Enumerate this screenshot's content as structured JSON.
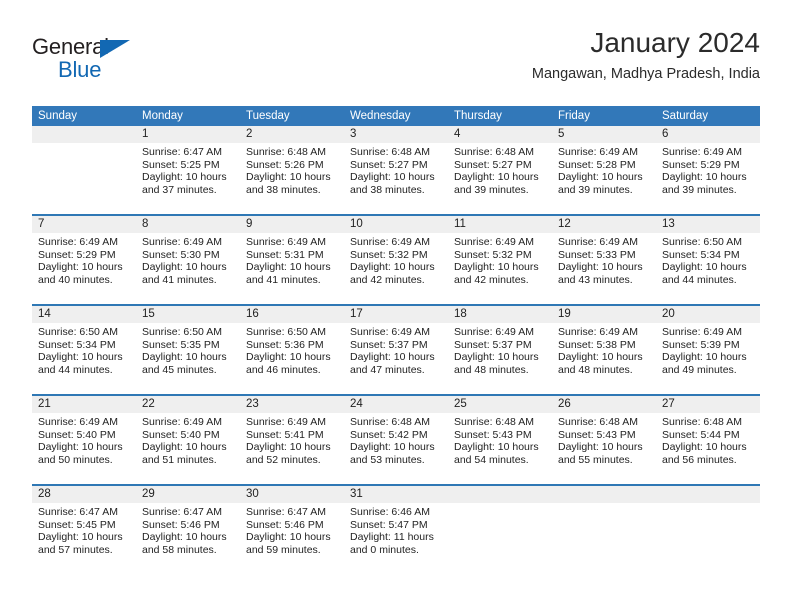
{
  "brand": {
    "name_part1": "General",
    "name_part2": "Blue",
    "accent_color": "#1268b3"
  },
  "header": {
    "title": "January 2024",
    "subtitle": "Mangawan, Madhya Pradesh, India"
  },
  "theme": {
    "header_bg": "#3278b9",
    "daynum_bg": "#efefef",
    "divider": "#2f78b5"
  },
  "weekday_headers": [
    "Sunday",
    "Monday",
    "Tuesday",
    "Wednesday",
    "Thursday",
    "Friday",
    "Saturday"
  ],
  "weeks": [
    [
      {
        "day": "",
        "sunrise": "",
        "sunset": "",
        "daylight_1": "",
        "daylight_2": ""
      },
      {
        "day": "1",
        "sunrise": "Sunrise: 6:47 AM",
        "sunset": "Sunset: 5:25 PM",
        "daylight_1": "Daylight: 10 hours",
        "daylight_2": "and 37 minutes."
      },
      {
        "day": "2",
        "sunrise": "Sunrise: 6:48 AM",
        "sunset": "Sunset: 5:26 PM",
        "daylight_1": "Daylight: 10 hours",
        "daylight_2": "and 38 minutes."
      },
      {
        "day": "3",
        "sunrise": "Sunrise: 6:48 AM",
        "sunset": "Sunset: 5:27 PM",
        "daylight_1": "Daylight: 10 hours",
        "daylight_2": "and 38 minutes."
      },
      {
        "day": "4",
        "sunrise": "Sunrise: 6:48 AM",
        "sunset": "Sunset: 5:27 PM",
        "daylight_1": "Daylight: 10 hours",
        "daylight_2": "and 39 minutes."
      },
      {
        "day": "5",
        "sunrise": "Sunrise: 6:49 AM",
        "sunset": "Sunset: 5:28 PM",
        "daylight_1": "Daylight: 10 hours",
        "daylight_2": "and 39 minutes."
      },
      {
        "day": "6",
        "sunrise": "Sunrise: 6:49 AM",
        "sunset": "Sunset: 5:29 PM",
        "daylight_1": "Daylight: 10 hours",
        "daylight_2": "and 39 minutes."
      }
    ],
    [
      {
        "day": "7",
        "sunrise": "Sunrise: 6:49 AM",
        "sunset": "Sunset: 5:29 PM",
        "daylight_1": "Daylight: 10 hours",
        "daylight_2": "and 40 minutes."
      },
      {
        "day": "8",
        "sunrise": "Sunrise: 6:49 AM",
        "sunset": "Sunset: 5:30 PM",
        "daylight_1": "Daylight: 10 hours",
        "daylight_2": "and 41 minutes."
      },
      {
        "day": "9",
        "sunrise": "Sunrise: 6:49 AM",
        "sunset": "Sunset: 5:31 PM",
        "daylight_1": "Daylight: 10 hours",
        "daylight_2": "and 41 minutes."
      },
      {
        "day": "10",
        "sunrise": "Sunrise: 6:49 AM",
        "sunset": "Sunset: 5:32 PM",
        "daylight_1": "Daylight: 10 hours",
        "daylight_2": "and 42 minutes."
      },
      {
        "day": "11",
        "sunrise": "Sunrise: 6:49 AM",
        "sunset": "Sunset: 5:32 PM",
        "daylight_1": "Daylight: 10 hours",
        "daylight_2": "and 42 minutes."
      },
      {
        "day": "12",
        "sunrise": "Sunrise: 6:49 AM",
        "sunset": "Sunset: 5:33 PM",
        "daylight_1": "Daylight: 10 hours",
        "daylight_2": "and 43 minutes."
      },
      {
        "day": "13",
        "sunrise": "Sunrise: 6:50 AM",
        "sunset": "Sunset: 5:34 PM",
        "daylight_1": "Daylight: 10 hours",
        "daylight_2": "and 44 minutes."
      }
    ],
    [
      {
        "day": "14",
        "sunrise": "Sunrise: 6:50 AM",
        "sunset": "Sunset: 5:34 PM",
        "daylight_1": "Daylight: 10 hours",
        "daylight_2": "and 44 minutes."
      },
      {
        "day": "15",
        "sunrise": "Sunrise: 6:50 AM",
        "sunset": "Sunset: 5:35 PM",
        "daylight_1": "Daylight: 10 hours",
        "daylight_2": "and 45 minutes."
      },
      {
        "day": "16",
        "sunrise": "Sunrise: 6:50 AM",
        "sunset": "Sunset: 5:36 PM",
        "daylight_1": "Daylight: 10 hours",
        "daylight_2": "and 46 minutes."
      },
      {
        "day": "17",
        "sunrise": "Sunrise: 6:49 AM",
        "sunset": "Sunset: 5:37 PM",
        "daylight_1": "Daylight: 10 hours",
        "daylight_2": "and 47 minutes."
      },
      {
        "day": "18",
        "sunrise": "Sunrise: 6:49 AM",
        "sunset": "Sunset: 5:37 PM",
        "daylight_1": "Daylight: 10 hours",
        "daylight_2": "and 48 minutes."
      },
      {
        "day": "19",
        "sunrise": "Sunrise: 6:49 AM",
        "sunset": "Sunset: 5:38 PM",
        "daylight_1": "Daylight: 10 hours",
        "daylight_2": "and 48 minutes."
      },
      {
        "day": "20",
        "sunrise": "Sunrise: 6:49 AM",
        "sunset": "Sunset: 5:39 PM",
        "daylight_1": "Daylight: 10 hours",
        "daylight_2": "and 49 minutes."
      }
    ],
    [
      {
        "day": "21",
        "sunrise": "Sunrise: 6:49 AM",
        "sunset": "Sunset: 5:40 PM",
        "daylight_1": "Daylight: 10 hours",
        "daylight_2": "and 50 minutes."
      },
      {
        "day": "22",
        "sunrise": "Sunrise: 6:49 AM",
        "sunset": "Sunset: 5:40 PM",
        "daylight_1": "Daylight: 10 hours",
        "daylight_2": "and 51 minutes."
      },
      {
        "day": "23",
        "sunrise": "Sunrise: 6:49 AM",
        "sunset": "Sunset: 5:41 PM",
        "daylight_1": "Daylight: 10 hours",
        "daylight_2": "and 52 minutes."
      },
      {
        "day": "24",
        "sunrise": "Sunrise: 6:48 AM",
        "sunset": "Sunset: 5:42 PM",
        "daylight_1": "Daylight: 10 hours",
        "daylight_2": "and 53 minutes."
      },
      {
        "day": "25",
        "sunrise": "Sunrise: 6:48 AM",
        "sunset": "Sunset: 5:43 PM",
        "daylight_1": "Daylight: 10 hours",
        "daylight_2": "and 54 minutes."
      },
      {
        "day": "26",
        "sunrise": "Sunrise: 6:48 AM",
        "sunset": "Sunset: 5:43 PM",
        "daylight_1": "Daylight: 10 hours",
        "daylight_2": "and 55 minutes."
      },
      {
        "day": "27",
        "sunrise": "Sunrise: 6:48 AM",
        "sunset": "Sunset: 5:44 PM",
        "daylight_1": "Daylight: 10 hours",
        "daylight_2": "and 56 minutes."
      }
    ],
    [
      {
        "day": "28",
        "sunrise": "Sunrise: 6:47 AM",
        "sunset": "Sunset: 5:45 PM",
        "daylight_1": "Daylight: 10 hours",
        "daylight_2": "and 57 minutes."
      },
      {
        "day": "29",
        "sunrise": "Sunrise: 6:47 AM",
        "sunset": "Sunset: 5:46 PM",
        "daylight_1": "Daylight: 10 hours",
        "daylight_2": "and 58 minutes."
      },
      {
        "day": "30",
        "sunrise": "Sunrise: 6:47 AM",
        "sunset": "Sunset: 5:46 PM",
        "daylight_1": "Daylight: 10 hours",
        "daylight_2": "and 59 minutes."
      },
      {
        "day": "31",
        "sunrise": "Sunrise: 6:46 AM",
        "sunset": "Sunset: 5:47 PM",
        "daylight_1": "Daylight: 11 hours",
        "daylight_2": "and 0 minutes."
      },
      {
        "day": "",
        "sunrise": "",
        "sunset": "",
        "daylight_1": "",
        "daylight_2": ""
      },
      {
        "day": "",
        "sunrise": "",
        "sunset": "",
        "daylight_1": "",
        "daylight_2": ""
      },
      {
        "day": "",
        "sunrise": "",
        "sunset": "",
        "daylight_1": "",
        "daylight_2": ""
      }
    ]
  ]
}
